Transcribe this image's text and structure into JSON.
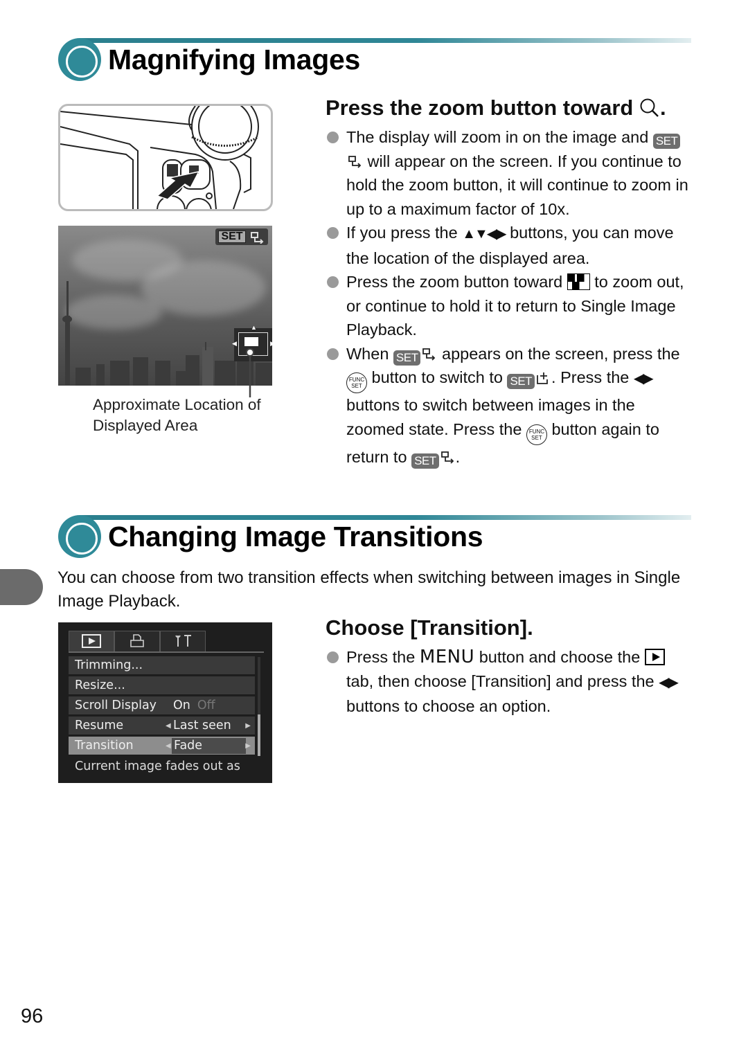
{
  "sections": [
    {
      "title": "Magnifying Images"
    },
    {
      "title": "Changing Image Transitions"
    }
  ],
  "magnify": {
    "step_title": "Press the zoom button toward",
    "step_title_end": ".",
    "bullets": {
      "b1": {
        "t1": "The display will zoom in on the image and",
        "t2": "will appear on the screen. If you continue to hold the zoom button, it will continue to zoom in up to a maximum factor of 10x."
      },
      "b2": {
        "t1": "If you press the",
        "t2": "buttons, you can move the location of the displayed area."
      },
      "b3": {
        "t1": "Press the zoom button toward",
        "t2": "to zoom out, or continue to hold it to return to Single Image Playback."
      },
      "b4": {
        "t1": "When",
        "t2": "appears on the screen, press the",
        "t3": "button to switch to",
        "t4": ". Press the",
        "t5": "buttons to switch between images in the zoomed state. Press the",
        "t6": "button again to return to",
        "t7": "."
      }
    },
    "caption_line1": "Approximate Location of",
    "caption_line2": "Displayed Area"
  },
  "icons": {
    "set": "SET",
    "func_top": "FUNC",
    "func_bottom": "SET",
    "up_down": "▲▼",
    "left_right": "◀▶",
    "menu_word": "MENU"
  },
  "transitions": {
    "intro": "You can choose from two transition effects when switching between images in Single Image Playback.",
    "step_title": "Choose [Transition].",
    "bullet": {
      "t1": "Press the",
      "t2": "button and choose the",
      "t3": "tab, then choose [Transition] and press the",
      "t4": "buttons to choose an option."
    }
  },
  "camera_menu": {
    "tabs": [
      "▶",
      "⎙",
      "🔧"
    ],
    "rows": [
      {
        "label": "Trimming..."
      },
      {
        "label": "Resize..."
      },
      {
        "label": "Scroll Display",
        "value_on": "On",
        "value_off": "Off"
      },
      {
        "label": "Resume",
        "value": "Last seen"
      },
      {
        "label": "Transition",
        "value": "Fade",
        "selected": true
      }
    ],
    "hint": "Current image fades out as",
    "photo_badge": "SET"
  },
  "page_number": "96"
}
